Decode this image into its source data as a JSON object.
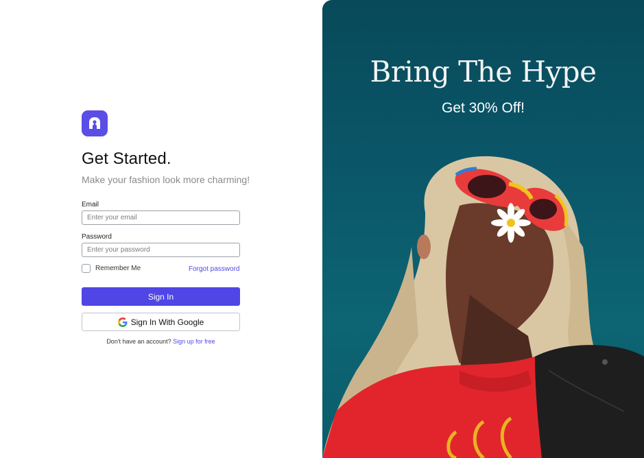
{
  "auth": {
    "title": "Get Started.",
    "subtitle": "Make your fashion look more charming!",
    "email_label": "Email",
    "email_placeholder": "Enter your email",
    "password_label": "Password",
    "password_placeholder": "Enter your password",
    "remember_label": "Remember Me",
    "forgot_label": "Forgot password",
    "signin_label": "Sign In",
    "google_label": "Sign In With Google",
    "footer_text": "Don't have an account?",
    "signup_label": "Sign up for free"
  },
  "promo": {
    "title": "Bring The Hype",
    "subtitle": "Get 30% Off!"
  },
  "colors": {
    "accent": "#4f46e5",
    "logo": "#5b4ee6",
    "promo_bg": "#0a5668"
  },
  "icons": [
    "logo-icon",
    "google-icon"
  ]
}
